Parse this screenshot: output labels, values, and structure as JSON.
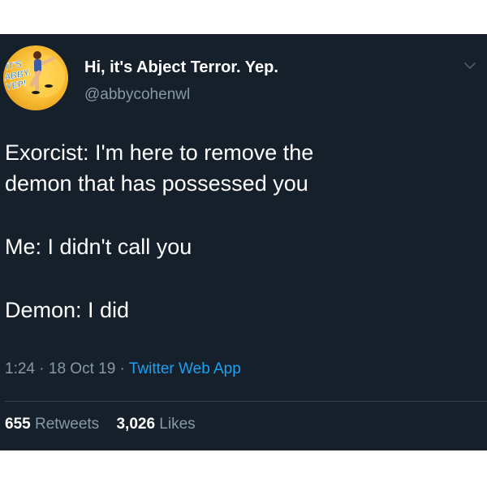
{
  "user": {
    "display_name": "Hi, it's Abject Terror. Yep.",
    "handle": "@abbycohenwl",
    "avatar_text": [
      "IT'S",
      "ABBY.",
      "YEP!"
    ]
  },
  "tweet": {
    "paragraphs": [
      [
        "Exorcist: I'm here to remove the",
        "demon that has possessed you"
      ],
      [
        "Me: I didn't call you"
      ],
      [
        "Demon: I did"
      ]
    ]
  },
  "meta": {
    "time": "1:24",
    "date": "18 Oct 19",
    "separator": "·",
    "source": "Twitter Web App"
  },
  "stats": {
    "retweets_count": "655",
    "retweets_label": "Retweets",
    "likes_count": "3,026",
    "likes_label": "Likes"
  },
  "icons": {
    "caret": "chevron-down-icon"
  },
  "colors": {
    "background": "#15202b",
    "text": "#ffffff",
    "secondary": "#8899a6",
    "link": "#1da1f2",
    "divider": "#38444d"
  }
}
